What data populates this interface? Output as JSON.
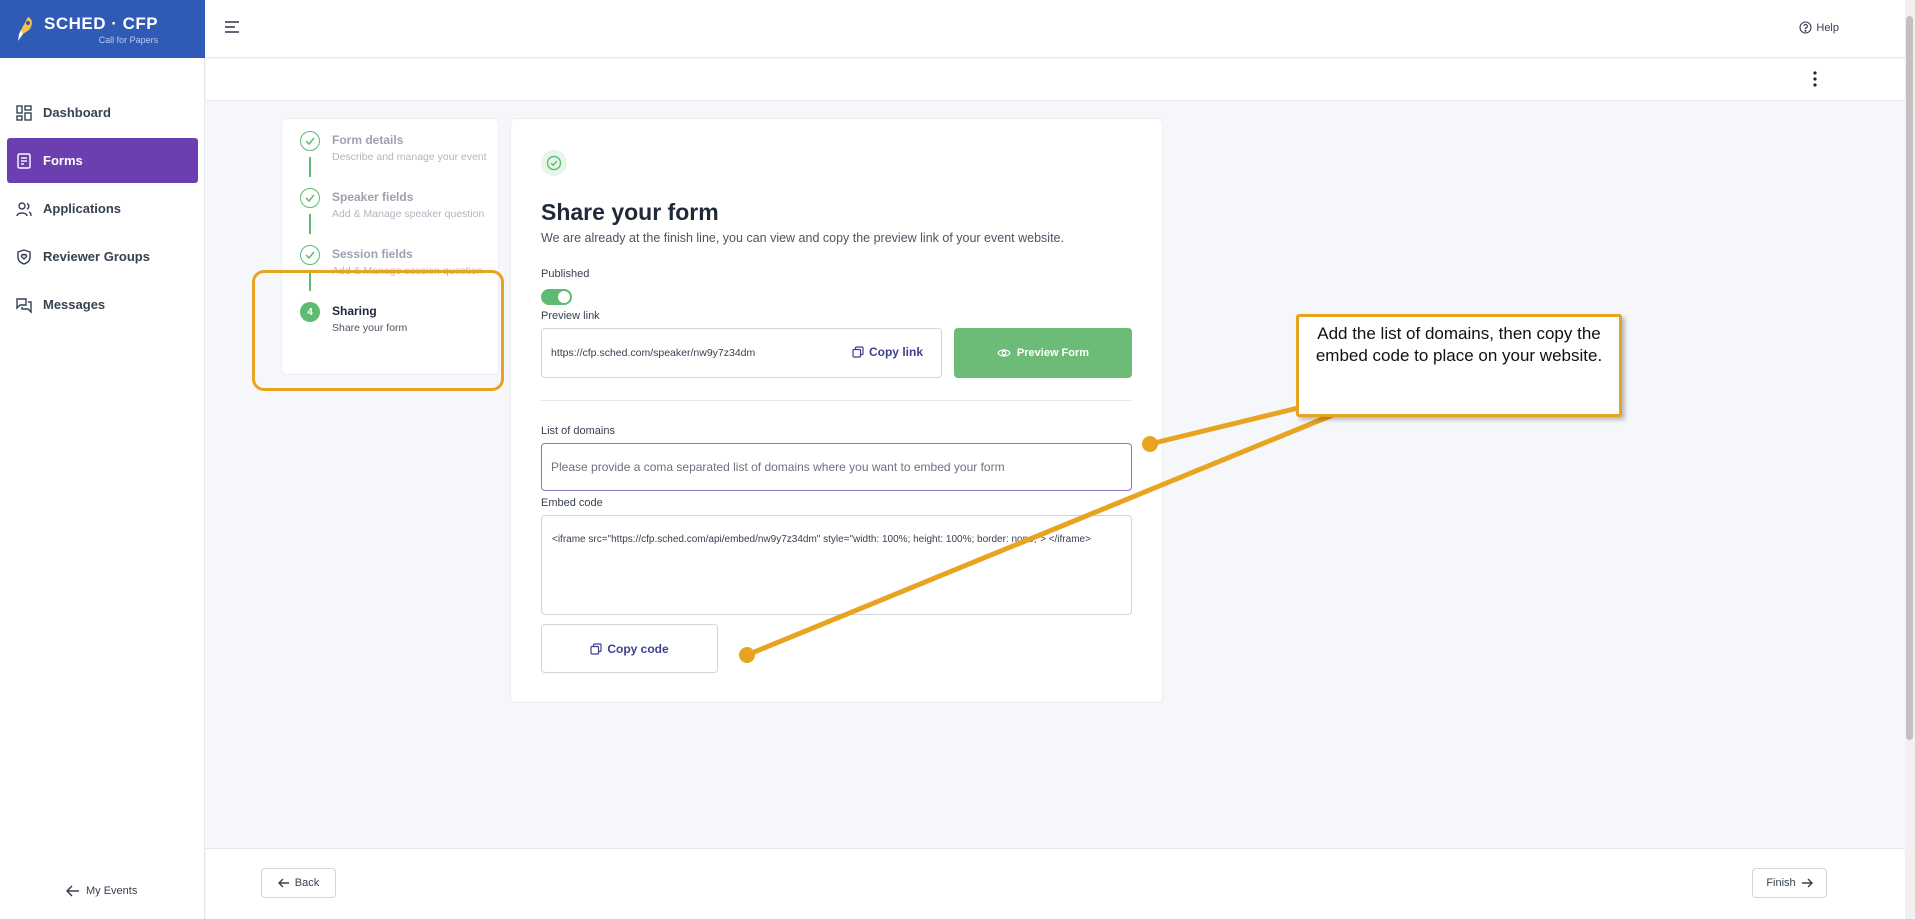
{
  "app": {
    "logo_title": "SCHED · CFP",
    "logo_subtitle": "Call for Papers",
    "help_label": "Help"
  },
  "sidebar": {
    "items": [
      {
        "label": "Dashboard",
        "icon": "dashboard-icon"
      },
      {
        "label": "Forms",
        "icon": "form-icon",
        "active": true
      },
      {
        "label": "Applications",
        "icon": "users-icon"
      },
      {
        "label": "Reviewer Groups",
        "icon": "shield-heart-icon"
      },
      {
        "label": "Messages",
        "icon": "messages-icon"
      }
    ],
    "my_events_label": "My Events"
  },
  "stepper": {
    "steps": [
      {
        "title": "Form details",
        "desc": "Describe and manage your event",
        "state": "done"
      },
      {
        "title": "Speaker fields",
        "desc": "Add & Manage speaker question",
        "state": "done"
      },
      {
        "title": "Session fields",
        "desc": "Add & Manage session question",
        "state": "done"
      },
      {
        "number": "4",
        "title": "Sharing",
        "desc": "Share your form",
        "state": "current"
      }
    ]
  },
  "share": {
    "title": "Share your form",
    "subtitle": "We are already at the finish line, you can view and copy the preview link of your event website.",
    "published_label": "Published",
    "published": true,
    "preview_link_label": "Preview link",
    "preview_url": "https://cfp.sched.com/speaker/nw9y7z34dm",
    "copy_link_label": "Copy link",
    "preview_form_label": "Preview Form",
    "domains_label": "List of domains",
    "domains_placeholder": "Please provide a coma separated list of domains where you want to embed your form",
    "domains_value": "",
    "embed_label": "Embed code",
    "embed_code": "<iframe src=\"https://cfp.sched.com/api/embed/nw9y7z34dm\" style=\"width: 100%; height: 100%; border: none;\"> </iframe>",
    "copy_code_label": "Copy code"
  },
  "callout": {
    "text": "Add the list of domains, then copy the embed code to place on your website."
  },
  "footer": {
    "back_label": "Back",
    "finish_label": "Finish"
  },
  "colors": {
    "brand_blue": "#2f5bb7",
    "active_purple": "#6b3fb0",
    "success_green": "#5dbb72",
    "callout_orange": "#e8a321"
  }
}
